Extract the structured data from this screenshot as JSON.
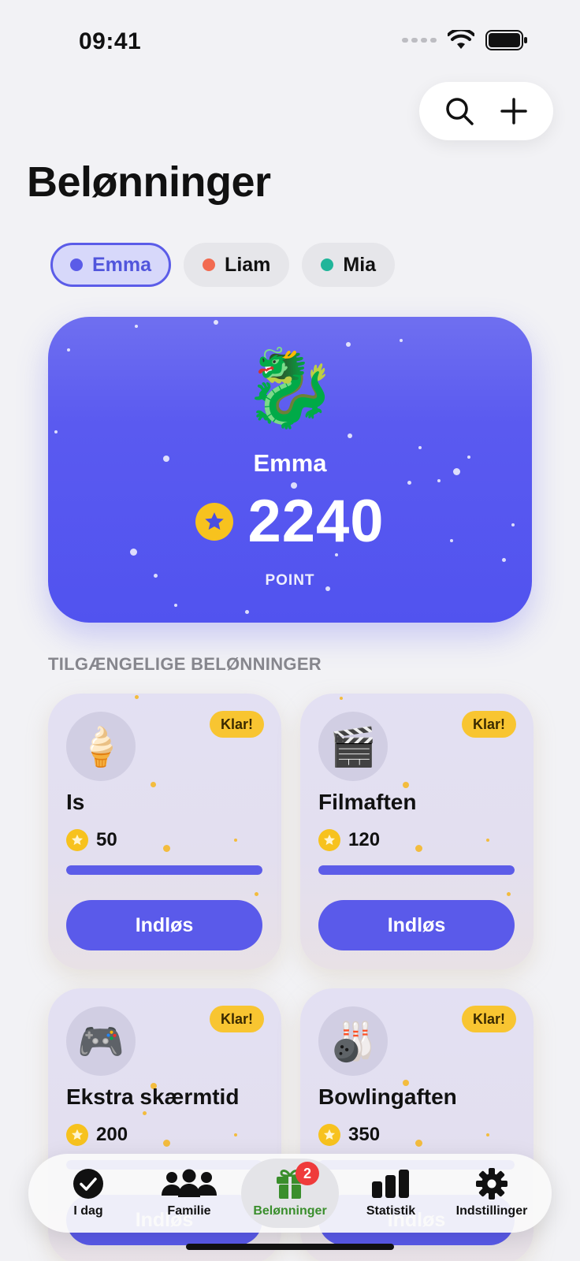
{
  "status_bar": {
    "time": "09:41"
  },
  "page": {
    "title": "Belønninger"
  },
  "people": [
    {
      "name": "Emma",
      "color": "#5b5ce8",
      "active": true
    },
    {
      "name": "Liam",
      "color": "#f26a50",
      "active": false
    },
    {
      "name": "Mia",
      "color": "#20b59a",
      "active": false
    }
  ],
  "hero": {
    "avatar": "🐉",
    "name": "Emma",
    "points": "2240",
    "unit": "POINT"
  },
  "section": {
    "label": "TILGÆNGELIGE BELØNNINGER"
  },
  "rewards": [
    {
      "icon": "🍦",
      "title": "Is",
      "cost": "50",
      "badge": "Klar!",
      "progress": 1.0,
      "button": "Indløs"
    },
    {
      "icon": "🎬",
      "title": "Filmaften",
      "cost": "120",
      "badge": "Klar!",
      "progress": 1.0,
      "button": "Indløs"
    },
    {
      "icon": "🎮",
      "title": "Ekstra skærmtid",
      "cost": "200",
      "badge": "Klar!",
      "progress": 1.0,
      "button": "Indløs"
    },
    {
      "icon": "🎳",
      "title": "Bowlingaften",
      "cost": "350",
      "badge": "Klar!",
      "progress": 1.0,
      "button": "Indløs"
    }
  ],
  "tabs": [
    {
      "label": "I dag",
      "icon": "checkmark-circle-icon",
      "active": false
    },
    {
      "label": "Familie",
      "icon": "people-icon",
      "active": false
    },
    {
      "label": "Belønninger",
      "icon": "gift-icon",
      "active": true,
      "badge": "2"
    },
    {
      "label": "Statistik",
      "icon": "bar-chart-icon",
      "active": false
    },
    {
      "label": "Indstillinger",
      "icon": "gear-icon",
      "active": false
    }
  ],
  "colors": {
    "accent": "#5a5aea",
    "gold": "#f7c21e",
    "active_tab": "#3a8e2c"
  }
}
